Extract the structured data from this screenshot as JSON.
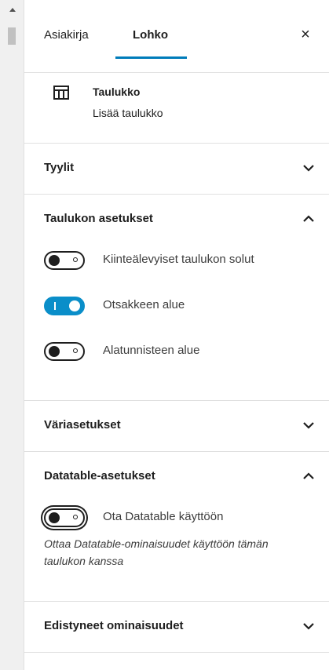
{
  "tabs": {
    "document": "Asiakirja",
    "block": "Lohko",
    "close": "×"
  },
  "block": {
    "icon": "table-icon",
    "title": "Taulukko",
    "description": "Lisää taulukko"
  },
  "sections": {
    "styles": {
      "title": "Tyylit",
      "expanded": false
    },
    "table_settings": {
      "title": "Taulukon asetukset",
      "expanded": true,
      "toggles": [
        {
          "label": "Kiinteälevyiset taulukon solut",
          "checked": false
        },
        {
          "label": "Otsakkeen alue",
          "checked": true
        },
        {
          "label": "Alatunnisteen alue",
          "checked": false
        }
      ]
    },
    "color_settings": {
      "title": "Väriasetukset",
      "expanded": false
    },
    "datatable_settings": {
      "title": "Datatable-asetukset",
      "expanded": true,
      "toggle": {
        "label": "Ota Datatable käyttöön",
        "checked": false
      },
      "help": "Ottaa Datatable-ominaisuudet käyttöön tämän taulukon kanssa"
    },
    "advanced": {
      "title": "Edistyneet ominaisuudet",
      "expanded": false
    }
  },
  "colors": {
    "accent": "#007cba",
    "toggle_on": "#0a8ec9"
  }
}
